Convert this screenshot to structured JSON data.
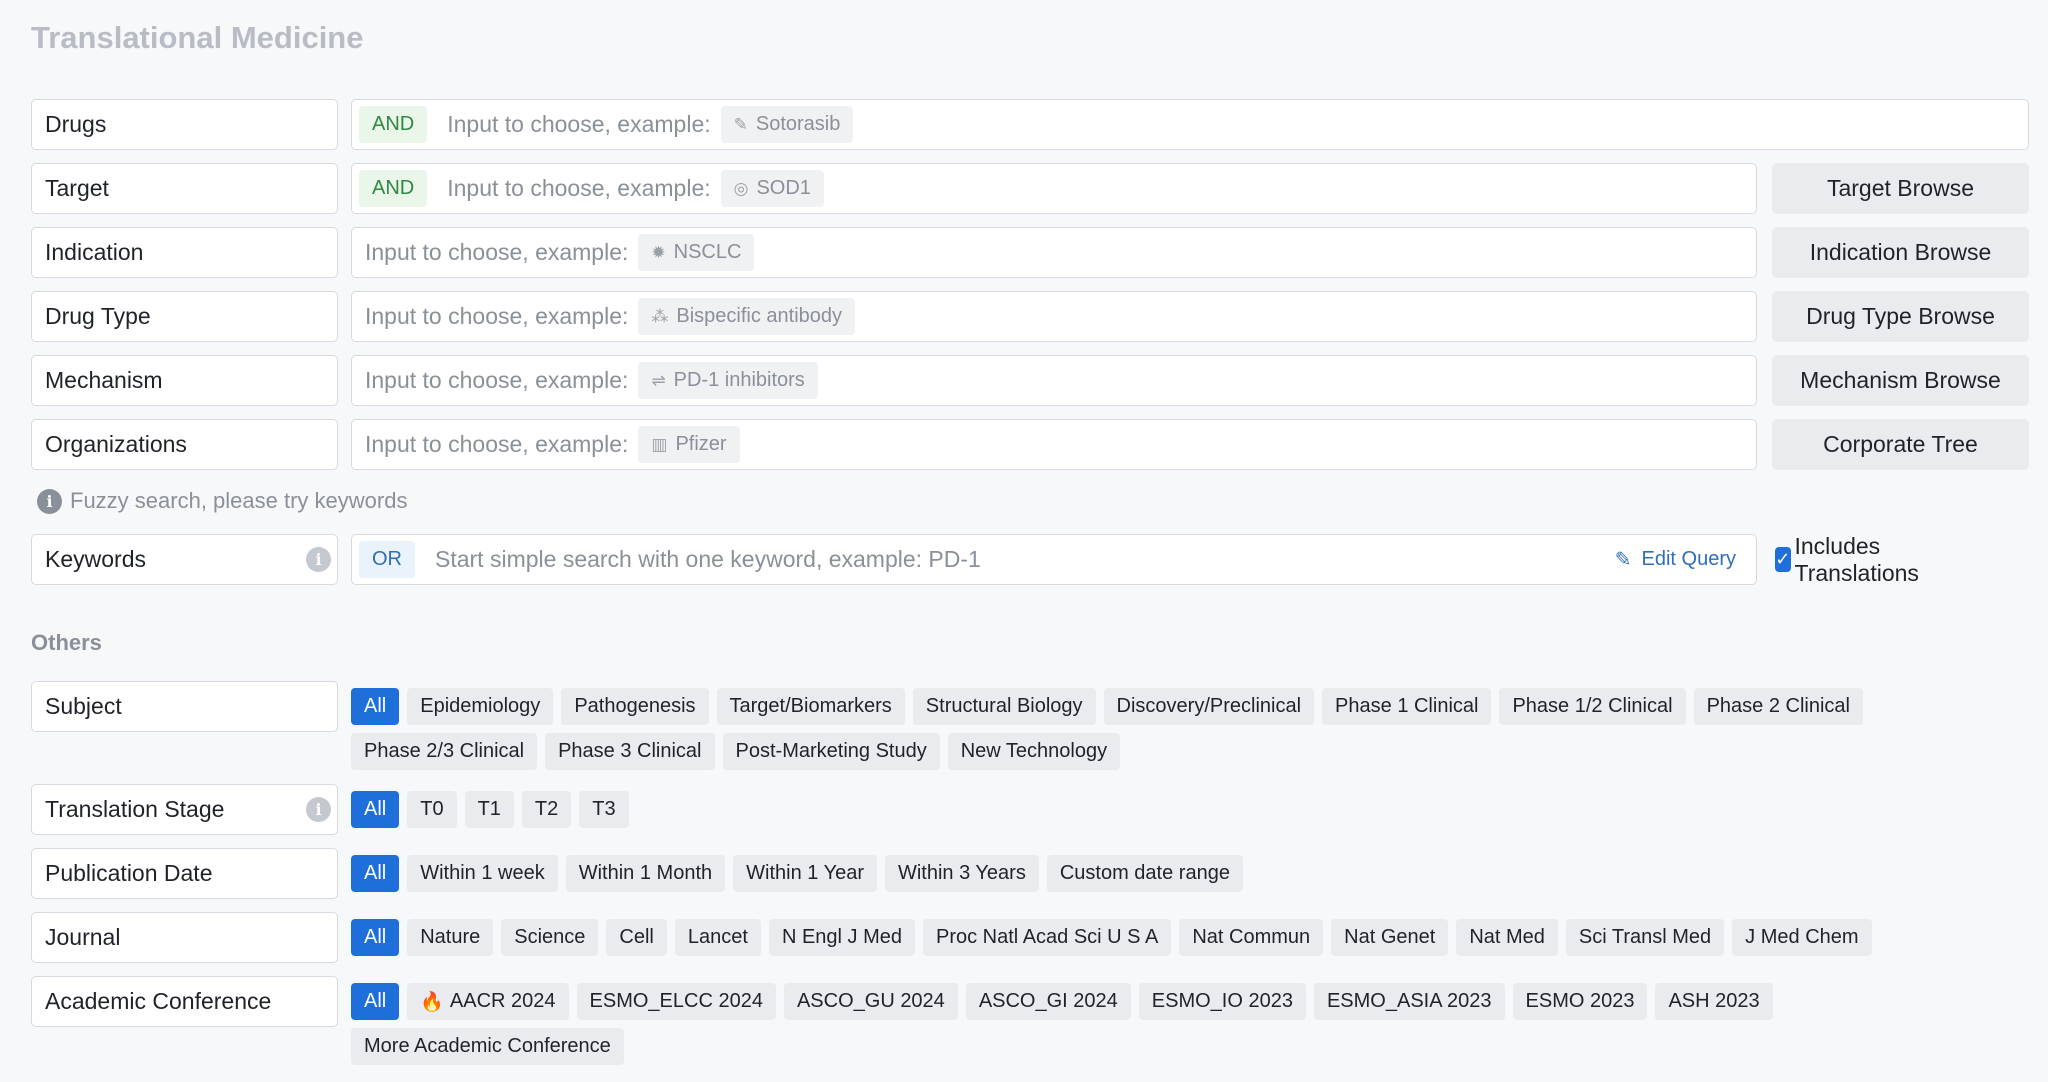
{
  "page": {
    "title": "Translational Medicine"
  },
  "filters": [
    {
      "label": "Drugs",
      "logic": "AND",
      "placeholder": "Input to choose, example:",
      "example": "Sotorasib",
      "example_icon": "pill-icon",
      "browse": ""
    },
    {
      "label": "Target",
      "logic": "AND",
      "placeholder": "Input to choose, example:",
      "example": "SOD1",
      "example_icon": "target-icon",
      "browse": "Target Browse"
    },
    {
      "label": "Indication",
      "logic": "",
      "placeholder": "Input to choose, example:",
      "example": "NSCLC",
      "example_icon": "virus-icon",
      "browse": "Indication Browse"
    },
    {
      "label": "Drug Type",
      "logic": "",
      "placeholder": "Input to choose, example:",
      "example": "Bispecific antibody",
      "example_icon": "molecule-icon",
      "browse": "Drug Type Browse"
    },
    {
      "label": "Mechanism",
      "logic": "",
      "placeholder": "Input to choose, example:",
      "example": "PD-1 inhibitors",
      "example_icon": "arrows-icon",
      "browse": "Mechanism Browse"
    },
    {
      "label": "Organizations",
      "logic": "",
      "placeholder": "Input to choose, example:",
      "example": "Pfizer",
      "example_icon": "building-icon",
      "browse": "Corporate Tree"
    }
  ],
  "hint": "Fuzzy search, please try keywords",
  "keywords": {
    "label": "Keywords",
    "logic": "OR",
    "placeholder": "Start simple search with one keyword, example:  PD-1",
    "edit_query": "Edit Query",
    "includes_translations": "Includes Translations",
    "includes_translations_checked": true
  },
  "others": {
    "title": "Others",
    "subject": {
      "label": "Subject",
      "options": [
        "All",
        "Epidemiology",
        "Pathogenesis",
        "Target/Biomarkers",
        "Structural Biology",
        "Discovery/Preclinical",
        "Phase 1 Clinical",
        "Phase 1/2 Clinical",
        "Phase 2 Clinical",
        "Phase 2/3 Clinical",
        "Phase 3 Clinical",
        "Post-Marketing Study",
        "New Technology"
      ]
    },
    "translation_stage": {
      "label": "Translation Stage",
      "options": [
        "All",
        "T0",
        "T1",
        "T2",
        "T3"
      ]
    },
    "publication_date": {
      "label": "Publication Date",
      "options": [
        "All",
        "Within 1 week",
        "Within 1 Month",
        "Within 1 Year",
        "Within 3 Years",
        "Custom date range"
      ]
    },
    "journal": {
      "label": "Journal",
      "options": [
        "All",
        "Nature",
        "Science",
        "Cell",
        "Lancet",
        "N Engl J Med",
        "Proc Natl Acad Sci U S A",
        "Nat Commun",
        "Nat Genet",
        "Nat Med",
        "Sci Transl Med",
        "J Med Chem"
      ]
    },
    "academic_conference": {
      "label": "Academic Conference",
      "options": [
        "All",
        "AACR 2024",
        "ESMO_ELCC 2024",
        "ASCO_GU 2024",
        "ASCO_GI 2024",
        "ESMO_IO 2023",
        "ESMO_ASIA 2023",
        "ESMO 2023",
        "ASH 2023",
        "More Academic Conference"
      ]
    }
  },
  "colors": {
    "accent": "#1e6fd9",
    "and_tag": "#2f8a3f",
    "or_tag": "#2f6fb8"
  }
}
